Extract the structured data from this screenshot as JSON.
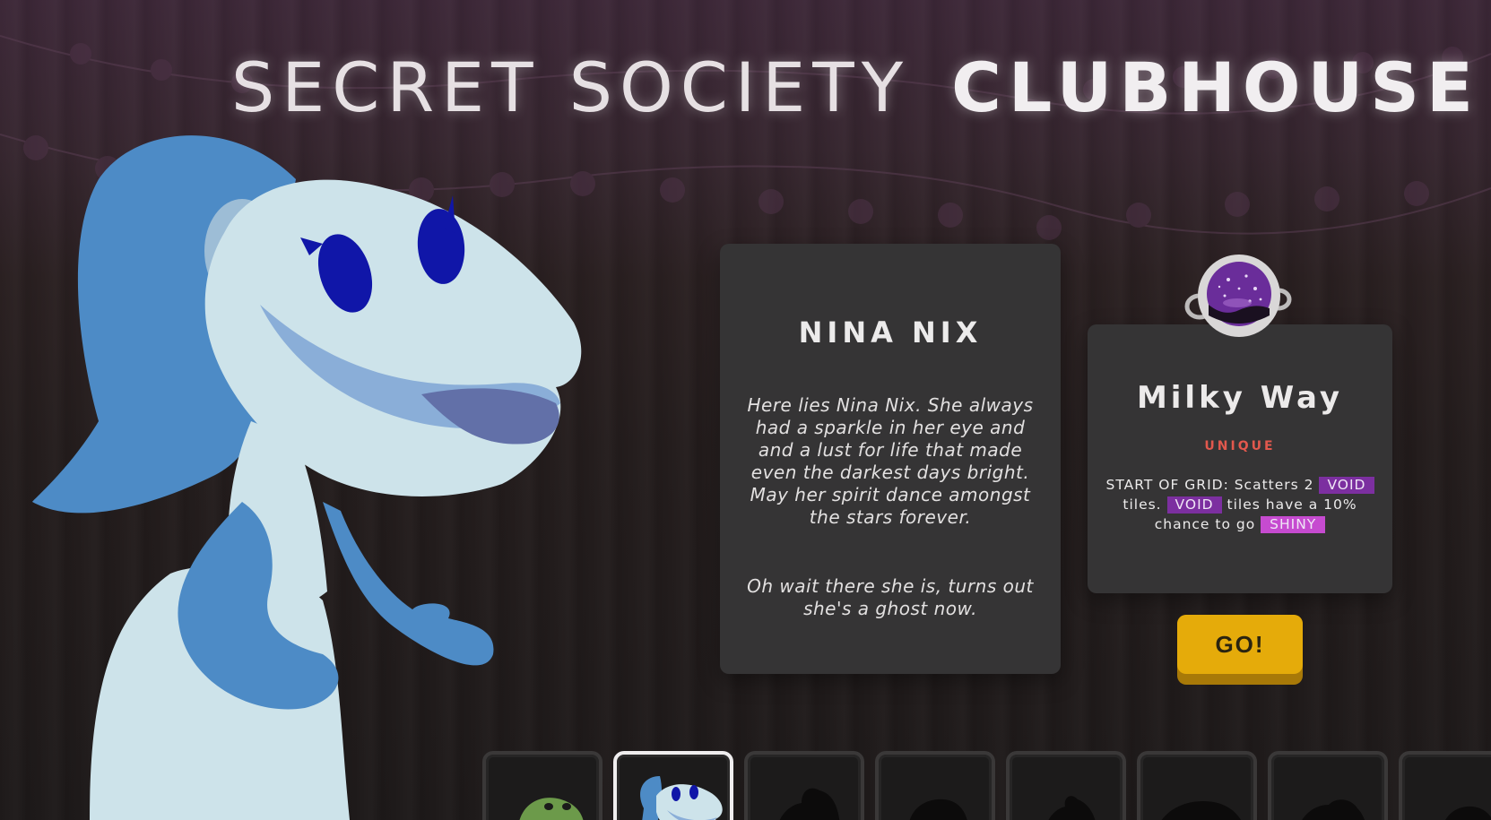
{
  "title": {
    "part1": "SECRET SOCIETY",
    "part2": "CLUBHOUSE"
  },
  "character": {
    "name": "NINA NIX",
    "bio": "Here lies Nina Nix. She always had a sparkle in her eye and and a lust for life that made even the darkest days bright. May her spirit dance amongst the stars forever.",
    "bio2": "Oh wait there she is, turns out she's a ghost now."
  },
  "item": {
    "name": "Milky Way",
    "rarity": "UNIQUE",
    "ability": {
      "prefix": "START OF GRID: Scatters 2",
      "tag1": "VOID",
      "mid1": "tiles.",
      "tag2": "VOID",
      "mid2": "tiles have a 10% chance to go",
      "tag3": "SHINY"
    },
    "icon": "galaxy-orb-icon"
  },
  "go_button": {
    "label": "GO!"
  },
  "roster": [
    {
      "name": "green-character-slot",
      "state": "unlocked"
    },
    {
      "name": "nina-nix-slot",
      "state": "selected"
    },
    {
      "name": "locked-slot-1",
      "state": "locked"
    },
    {
      "name": "locked-slot-2",
      "state": "locked"
    },
    {
      "name": "locked-slot-3",
      "state": "locked"
    },
    {
      "name": "locked-slot-4",
      "state": "locked"
    },
    {
      "name": "locked-slot-5",
      "state": "locked"
    },
    {
      "name": "locked-slot-6",
      "state": "locked"
    }
  ],
  "colors": {
    "accent_go": "#e5ab0a",
    "void_tag": "#7c2fa0",
    "shiny_tag": "#c64bd0",
    "rarity": "#e2584d",
    "card": "#353435"
  }
}
